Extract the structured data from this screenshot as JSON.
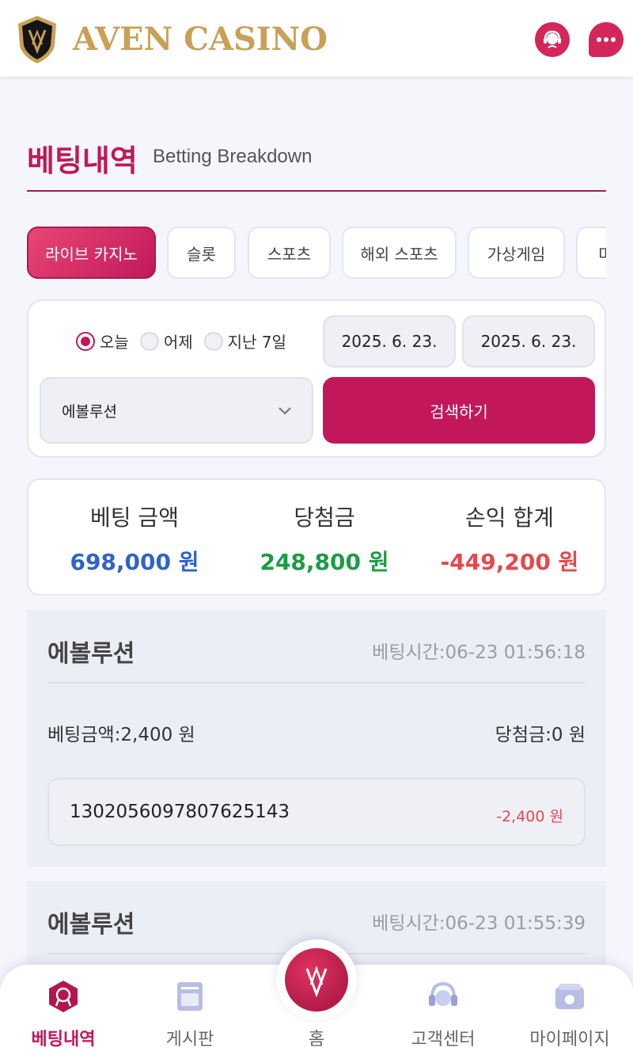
{
  "header": {
    "brand": "AVEN CASINO",
    "support_icon": "support-agent-icon",
    "chat_icon": "chat-bubble-icon"
  },
  "section": {
    "title_ko": "베팅내역",
    "title_en": "Betting Breakdown"
  },
  "tabs": [
    {
      "label": "라이브 카지노",
      "active": true
    },
    {
      "label": "슬롯",
      "active": false
    },
    {
      "label": "스포츠",
      "active": false
    },
    {
      "label": "해외 스포츠",
      "active": false
    },
    {
      "label": "가상게임",
      "active": false
    },
    {
      "label": "미",
      "active": false
    }
  ],
  "filter": {
    "radios": [
      {
        "label": "오늘",
        "checked": true
      },
      {
        "label": "어제",
        "checked": false
      },
      {
        "label": "지난 7일",
        "checked": false
      }
    ],
    "date_from": "2025. 6. 23.",
    "date_to": "2025. 6. 23.",
    "game_select": "에볼루션",
    "search_label": "검색하기"
  },
  "summary": {
    "bet_label": "베팅 금액",
    "bet_value": "698,000 원",
    "win_label": "당첨금",
    "win_value": "248,800 원",
    "profit_label": "손익 합계",
    "profit_value": "-449,200 원"
  },
  "records": [
    {
      "game": "에볼루션",
      "time": "베팅시간:06-23 01:56:18",
      "bet": "베팅금액:2,400 원",
      "win": "당첨금:0 원",
      "id": "1302056097807625143",
      "amount": "-2,400 원"
    },
    {
      "game": "에볼루션",
      "time": "베팅시간:06-23 01:55:39"
    }
  ],
  "nav": {
    "betting": "베팅내역",
    "board": "게시판",
    "home": "홈",
    "support": "고객센터",
    "mypage": "마이페이지"
  },
  "colors": {
    "accent": "#c2185b",
    "gold": "#c9a055",
    "positive": "#1d9b48",
    "negative": "#e5484d",
    "bet_blue": "#2f63c9"
  }
}
